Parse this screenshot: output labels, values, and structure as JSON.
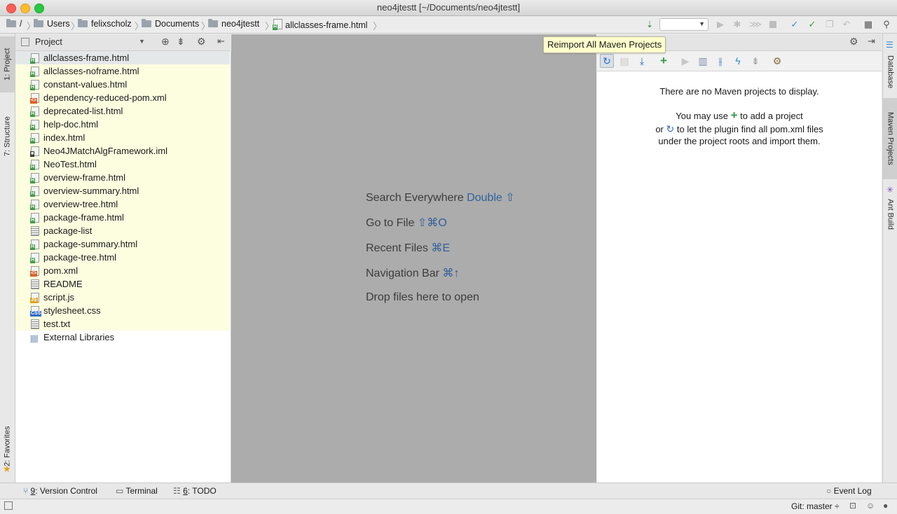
{
  "window": {
    "title": "neo4jtestt [~/Documents/neo4jtestt]"
  },
  "navbar": {
    "breadcrumbs": [
      "/",
      "Users",
      "felixscholz",
      "Documents",
      "neo4jtestt",
      "allclasses-frame.html"
    ]
  },
  "left_strip": {
    "project_tab": "1: Project",
    "structure_tab": "7: Structure",
    "favorites_tab": "2: Favorites"
  },
  "project_panel": {
    "title": "Project",
    "files": [
      {
        "name": "allclasses-frame.html",
        "type": "html"
      },
      {
        "name": "allclasses-noframe.html",
        "type": "html"
      },
      {
        "name": "constant-values.html",
        "type": "html"
      },
      {
        "name": "dependency-reduced-pom.xml",
        "type": "xml"
      },
      {
        "name": "deprecated-list.html",
        "type": "html"
      },
      {
        "name": "help-doc.html",
        "type": "html"
      },
      {
        "name": "index.html",
        "type": "html"
      },
      {
        "name": "Neo4JMatchAlgFramework.iml",
        "type": "iml"
      },
      {
        "name": "NeoTest.html",
        "type": "html"
      },
      {
        "name": "overview-frame.html",
        "type": "html"
      },
      {
        "name": "overview-summary.html",
        "type": "html"
      },
      {
        "name": "overview-tree.html",
        "type": "html"
      },
      {
        "name": "package-frame.html",
        "type": "html"
      },
      {
        "name": "package-list",
        "type": "text"
      },
      {
        "name": "package-summary.html",
        "type": "html"
      },
      {
        "name": "package-tree.html",
        "type": "html"
      },
      {
        "name": "pom.xml",
        "type": "xml"
      },
      {
        "name": "README",
        "type": "text"
      },
      {
        "name": "script.js",
        "type": "js"
      },
      {
        "name": "stylesheet.css",
        "type": "css"
      },
      {
        "name": "test.txt",
        "type": "text"
      }
    ],
    "external_libraries": "External Libraries"
  },
  "editor": {
    "hints": [
      {
        "text": "Search Everywhere",
        "key": "Double ⇧"
      },
      {
        "text": "Go to File",
        "key": "⇧⌘O"
      },
      {
        "text": "Recent Files",
        "key": "⌘E"
      },
      {
        "text": "Navigation Bar",
        "key": "⌘↑"
      },
      {
        "text": "Drop files here to open",
        "key": ""
      }
    ]
  },
  "maven": {
    "tooltip": "Reimport All Maven Projects",
    "empty_line1": "There are no Maven projects to display.",
    "empty_line2a": "You may use",
    "empty_line2b": "to add a project",
    "empty_line3a": "or",
    "empty_line3b": "to let the plugin find all pom.xml files",
    "empty_line4": "under the project roots and import them."
  },
  "right_strip": {
    "database_tab": "Database",
    "maven_tab": "Maven Projects",
    "ant_tab": "Ant Build"
  },
  "bottom_bar": {
    "version_control_num": "9",
    "version_control": ": Version Control",
    "terminal": "Terminal",
    "todo_num": "6",
    "todo": ": TODO",
    "event_log": "Event Log"
  },
  "status_bar": {
    "git": "Git: master ÷"
  },
  "colors": {
    "accent_blue": "#2e6bc6",
    "add_green": "#2f9e44",
    "file_highlight": "#fdfde0",
    "editor_bg": "#acacac"
  }
}
